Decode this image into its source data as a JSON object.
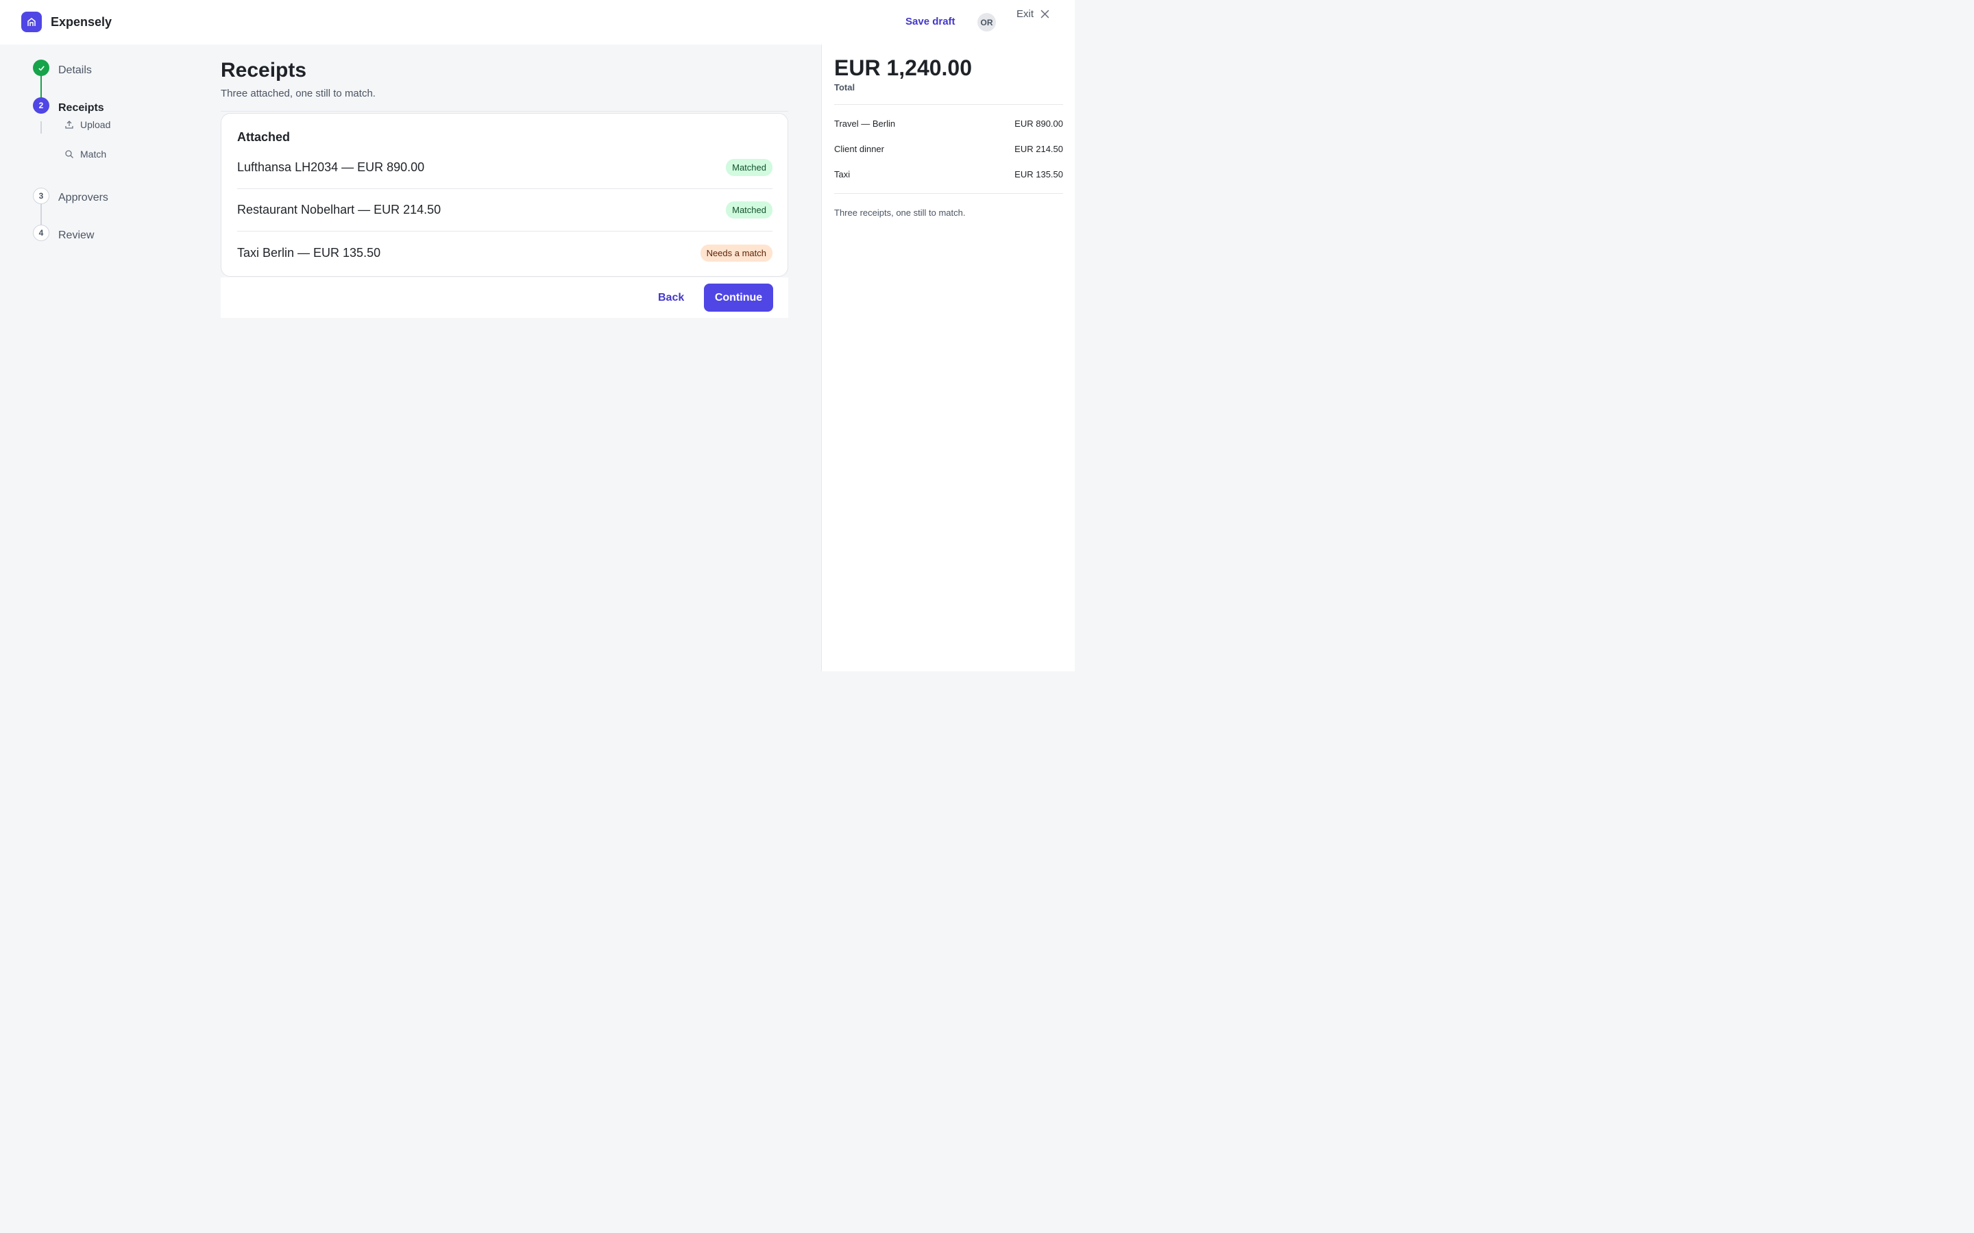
{
  "app": {
    "name": "Expensely"
  },
  "header": {
    "save_draft_label": "Save draft",
    "avatar_initials": "OR",
    "exit_label": "Exit"
  },
  "stepper": {
    "steps": [
      {
        "label": "Details",
        "marker": "",
        "state": "done"
      },
      {
        "label": "Receipts",
        "marker": "2",
        "state": "current"
      },
      {
        "label": "Approvers",
        "marker": "3",
        "state": "todo"
      },
      {
        "label": "Review",
        "marker": "4",
        "state": "todo"
      }
    ],
    "substeps": [
      {
        "label": "Upload",
        "icon": "upload-icon"
      },
      {
        "label": "Match",
        "icon": "search-icon"
      }
    ]
  },
  "main": {
    "title": "Receipts",
    "subtitle": "Three attached, one still to match.",
    "card_title": "Attached",
    "receipts": [
      {
        "text": "Lufthansa LH2034 — EUR 890.00",
        "status": "Matched",
        "status_type": "ok"
      },
      {
        "text": "Restaurant Nobelhart — EUR 214.50",
        "status": "Matched",
        "status_type": "ok"
      },
      {
        "text": "Taxi Berlin — EUR 135.50",
        "status": "Needs a match",
        "status_type": "warn"
      }
    ],
    "back_label": "Back",
    "continue_label": "Continue"
  },
  "summary": {
    "total": "EUR 1,240.00",
    "total_label": "Total",
    "lines": [
      {
        "label": "Travel — Berlin",
        "amount": "EUR 890.00"
      },
      {
        "label": "Client dinner",
        "amount": "EUR 214.50"
      },
      {
        "label": "Taxi",
        "amount": "EUR 135.50"
      }
    ],
    "note": "Three receipts, one still to match."
  },
  "colors": {
    "accent": "#4f46e5",
    "success": "#16a34a",
    "matched_badge": "#d1fadf",
    "warning_badge": "#ffe4d0"
  }
}
